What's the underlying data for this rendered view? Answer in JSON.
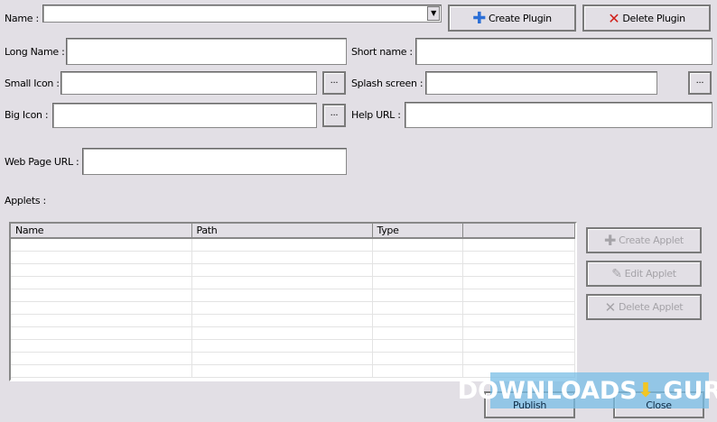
{
  "form": {
    "name_label": "Name :",
    "name_value": "",
    "long_name_label": "Long Name :",
    "short_name_label": "Short name :",
    "small_icon_label": "Small Icon :",
    "splash_label": "Splash screen :",
    "big_icon_label": "Big Icon :",
    "help_url_label": "Help URL :",
    "web_page_label": "Web Page URL :",
    "applets_label": "Applets :",
    "browse": "..."
  },
  "buttons": {
    "create_plugin": "Create Plugin",
    "delete_plugin": "Delete Plugin",
    "create_applet": "Create Applet",
    "edit_applet": "Edit Applet",
    "delete_applet": "Delete Applet",
    "publish": "Publish",
    "close": "Close"
  },
  "table": {
    "columns": [
      "Name",
      "Path",
      "Type",
      ""
    ]
  },
  "watermark": {
    "left": "DOWNLOADS",
    "right": ".GURU"
  }
}
